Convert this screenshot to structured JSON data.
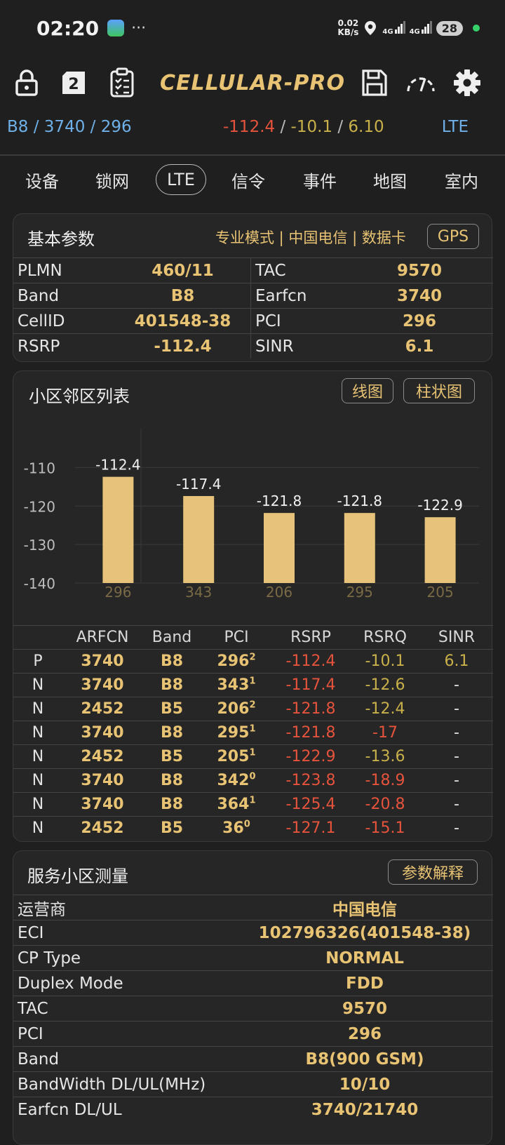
{
  "status": {
    "time": "02:20",
    "dots": "···",
    "net_speed_value": "0.02",
    "net_speed_unit": "KB/s",
    "sim1": "4G",
    "sim2": "4G",
    "battery": "28"
  },
  "toolbar": {
    "sim_slot": "2",
    "logo": "CELLULAR-PRO"
  },
  "info_line": {
    "band": "B8",
    "earfcn": "3740",
    "pci": "296",
    "sep": " / ",
    "rsrp": "-112.4",
    "rsrq": "-10.1",
    "sinr": "6.10",
    "tech": "LTE"
  },
  "tabs": [
    "设备",
    "锁网",
    "LTE",
    "信令",
    "事件",
    "地图",
    "室内"
  ],
  "basic": {
    "title": "基本参数",
    "tags": "专业模式 | 中国电信 | 数据卡",
    "gps_btn": "GPS",
    "rows": [
      {
        "l1": "PLMN",
        "v1": "460/11",
        "l2": "TAC",
        "v2": "9570"
      },
      {
        "l1": "Band",
        "v1": "B8",
        "l2": "Earfcn",
        "v2": "3740"
      },
      {
        "l1": "CellID",
        "v1": "401548-38",
        "l2": "PCI",
        "v2": "296"
      },
      {
        "l1": "RSRP",
        "v1": "-112.4",
        "l2": "SINR",
        "v2": "6.1"
      }
    ]
  },
  "neighbors": {
    "title": "小区邻区列表",
    "btn_line": "线图",
    "btn_bar": "柱状图",
    "headers": [
      "",
      "ARFCN",
      "Band",
      "PCI",
      "RSRP",
      "RSRQ",
      "SINR"
    ],
    "rows": [
      {
        "type": "P",
        "arfcn": "3740",
        "band": "B8",
        "pci": "296",
        "sup": "2",
        "rsrp": "-112.4",
        "rsrq": "-10.1",
        "rsrq_color": "#c8b04a",
        "sinr": "6.1"
      },
      {
        "type": "N",
        "arfcn": "3740",
        "band": "B8",
        "pci": "343",
        "sup": "1",
        "rsrp": "-117.4",
        "rsrq": "-12.6",
        "rsrq_color": "#c8b04a",
        "sinr": "-"
      },
      {
        "type": "N",
        "arfcn": "2452",
        "band": "B5",
        "pci": "206",
        "sup": "2",
        "rsrp": "-121.8",
        "rsrq": "-12.4",
        "rsrq_color": "#c8b04a",
        "sinr": "-"
      },
      {
        "type": "N",
        "arfcn": "3740",
        "band": "B8",
        "pci": "295",
        "sup": "1",
        "rsrp": "-121.8",
        "rsrq": "-17",
        "rsrq_color": "#e5533c",
        "sinr": "-"
      },
      {
        "type": "N",
        "arfcn": "2452",
        "band": "B5",
        "pci": "205",
        "sup": "1",
        "rsrp": "-122.9",
        "rsrq": "-13.6",
        "rsrq_color": "#c8b04a",
        "sinr": "-"
      },
      {
        "type": "N",
        "arfcn": "3740",
        "band": "B8",
        "pci": "342",
        "sup": "0",
        "rsrp": "-123.8",
        "rsrq": "-18.9",
        "rsrq_color": "#e5533c",
        "sinr": "-"
      },
      {
        "type": "N",
        "arfcn": "3740",
        "band": "B8",
        "pci": "364",
        "sup": "1",
        "rsrp": "-125.4",
        "rsrq": "-20.8",
        "rsrq_color": "#e5533c",
        "sinr": "-"
      },
      {
        "type": "N",
        "arfcn": "2452",
        "band": "B5",
        "pci": "36",
        "sup": "0",
        "rsrp": "-127.1",
        "rsrq": "-15.1",
        "rsrq_color": "#e5533c",
        "sinr": "-"
      }
    ]
  },
  "chart_data": {
    "type": "bar",
    "categories": [
      "296",
      "343",
      "206",
      "295",
      "205"
    ],
    "values": [
      -112.4,
      -117.4,
      -121.8,
      -121.8,
      -122.9
    ],
    "yticks": [
      -110,
      -120,
      -130,
      -140
    ],
    "ylim": [
      -140,
      -105
    ],
    "bar_color": "#e6c27a",
    "title": "",
    "xlabel": "",
    "ylabel": ""
  },
  "serving": {
    "title": "服务小区测量",
    "btn": "参数解释",
    "rows": [
      {
        "label": "运营商",
        "value": "中国电信"
      },
      {
        "label": "ECI",
        "value": "102796326(401548-38)"
      },
      {
        "label": "CP Type",
        "value": "NORMAL"
      },
      {
        "label": "Duplex Mode",
        "value": "FDD"
      },
      {
        "label": "TAC",
        "value": "9570"
      },
      {
        "label": "PCI",
        "value": "296"
      },
      {
        "label": "Band",
        "value": "B8(900 GSM)"
      },
      {
        "label": "BandWidth DL/UL(MHz)",
        "value": "10/10"
      },
      {
        "label": "Earfcn DL/UL",
        "value": "3740/21740"
      }
    ]
  }
}
